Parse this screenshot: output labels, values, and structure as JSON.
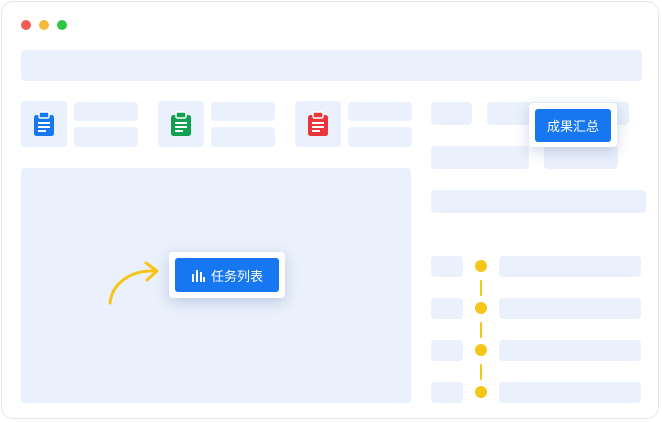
{
  "colors": {
    "window_close": "#f35b56",
    "window_minimize": "#f6b93b",
    "window_maximize": "#31c548",
    "accent": "#1677f0",
    "placeholder": "#eaf1fc",
    "timeline": "#f5c518",
    "clipboard_blue": "#1677f0",
    "clipboard_green": "#12a151",
    "clipboard_red": "#e8363a"
  },
  "icons": {
    "clipboard": "clipboard-icon",
    "chart": "bar-chart-icon",
    "arrow": "curved-arrow-icon"
  },
  "buttons": {
    "results_summary": "成果汇总",
    "task_list": "任务列表"
  }
}
